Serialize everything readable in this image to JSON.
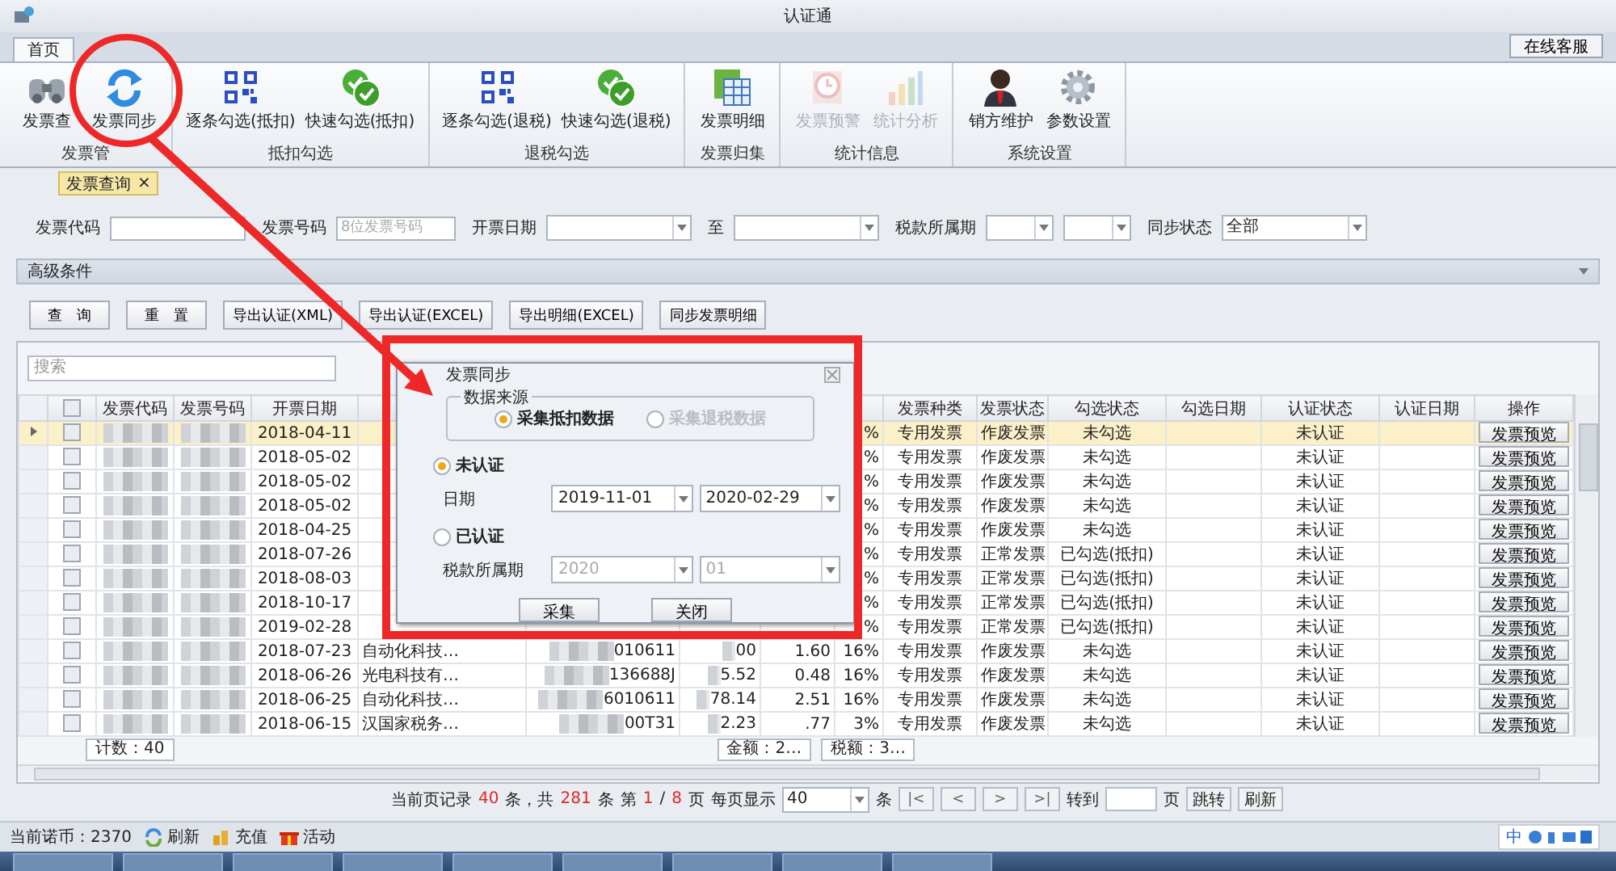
{
  "window": {
    "title": "认证通",
    "service_button": "在线客服"
  },
  "tabs": [
    {
      "label": "首页",
      "selected": true
    }
  ],
  "ribbon": [
    {
      "group": "发票管",
      "items": [
        {
          "label": "发票查",
          "kind": "binoculars",
          "disabled": false
        },
        {
          "label": "发票同步",
          "kind": "sync",
          "disabled": false
        }
      ]
    },
    {
      "group": "抵扣勾选",
      "items": [
        {
          "label": "逐条勾选(抵扣)",
          "kind": "qr",
          "disabled": false
        },
        {
          "label": "快速勾选(抵扣)",
          "kind": "check",
          "disabled": false
        }
      ]
    },
    {
      "group": "退税勾选",
      "items": [
        {
          "label": "逐条勾选(退税)",
          "kind": "qr",
          "disabled": false
        },
        {
          "label": "快速勾选(退税)",
          "kind": "check",
          "disabled": false
        }
      ]
    },
    {
      "group": "发票归集",
      "items": [
        {
          "label": "发票明细",
          "kind": "sheet",
          "disabled": false
        }
      ]
    },
    {
      "group": "统计信息",
      "items": [
        {
          "label": "发票预警",
          "kind": "clock",
          "disabled": true
        },
        {
          "label": "统计分析",
          "kind": "bars",
          "disabled": true
        }
      ]
    },
    {
      "group": "系统设置",
      "items": [
        {
          "label": "销方维护",
          "kind": "person",
          "disabled": false
        },
        {
          "label": "参数设置",
          "kind": "gear",
          "disabled": false
        }
      ]
    }
  ],
  "doc_tab": {
    "label": "发票查询",
    "close": "×"
  },
  "filters": [
    {
      "kind": "text",
      "label": "发票代码"
    },
    {
      "kind": "text",
      "label": "发票号码",
      "placeholder": "8位发票号码"
    },
    {
      "kind": "combo",
      "label": "开票日期"
    },
    {
      "kind": "combo",
      "label": "至"
    },
    {
      "kind": "combo",
      "label": "税款所属期"
    },
    {
      "kind": "combo"
    },
    {
      "kind": "combo",
      "label": "同步状态",
      "value": "全部"
    }
  ],
  "advanced": "高级条件",
  "actions": [
    "查　询",
    "重　置",
    "导出认证(XML)",
    "导出认证(EXCEL)",
    "导出明细(EXCEL)",
    "同步发票明细"
  ],
  "grid": {
    "search_placeholder": "搜索",
    "all_checked": false,
    "headers": {
      "code": "发票代码",
      "number": "发票号码",
      "date": "开票日期",
      "type": "发票种类",
      "status": "发票状态",
      "check": "勾选状态",
      "check_date": "勾选日期",
      "auth": "认证状态",
      "auth_date": "认证日期",
      "action": "操作"
    },
    "rows": [
      {
        "selected": true,
        "checked": false,
        "date": "2018-04-11",
        "rate": "%",
        "type": "专用发票",
        "status": "作废发票",
        "check": "未勾选",
        "auth": "未认证",
        "action": "发票预览"
      },
      {
        "selected": false,
        "checked": false,
        "date": "2018-05-02",
        "rate": "%",
        "type": "专用发票",
        "status": "作废发票",
        "check": "未勾选",
        "auth": "未认证",
        "action": "发票预览"
      },
      {
        "selected": false,
        "checked": false,
        "date": "2018-05-02",
        "rate": "%",
        "type": "专用发票",
        "status": "作废发票",
        "check": "未勾选",
        "auth": "未认证",
        "action": "发票预览"
      },
      {
        "selected": false,
        "checked": false,
        "date": "2018-05-02",
        "rate": "%",
        "type": "专用发票",
        "status": "作废发票",
        "check": "未勾选",
        "auth": "未认证",
        "action": "发票预览"
      },
      {
        "selected": false,
        "checked": false,
        "date": "2018-04-25",
        "rate": "%",
        "type": "专用发票",
        "status": "作废发票",
        "check": "未勾选",
        "auth": "未认证",
        "action": "发票预览"
      },
      {
        "selected": false,
        "checked": false,
        "date": "2018-07-26",
        "rate": "%",
        "type": "专用发票",
        "status": "正常发票",
        "check": "已勾选(抵扣)",
        "auth": "未认证",
        "action": "发票预览"
      },
      {
        "selected": false,
        "checked": false,
        "date": "2018-08-03",
        "rate": "%",
        "type": "专用发票",
        "status": "正常发票",
        "check": "已勾选(抵扣)",
        "auth": "未认证",
        "action": "发票预览"
      },
      {
        "selected": false,
        "checked": false,
        "date": "2018-10-17",
        "rate": "%",
        "type": "专用发票",
        "status": "正常发票",
        "check": "已勾选(抵扣)",
        "auth": "未认证",
        "action": "发票预览"
      },
      {
        "selected": false,
        "checked": false,
        "date": "2019-02-28",
        "rate": "%",
        "type": "专用发票",
        "status": "正常发票",
        "check": "已勾选(抵扣)",
        "auth": "未认证",
        "action": "发票预览"
      },
      {
        "selected": false,
        "checked": false,
        "date": "2018-07-23",
        "name": "自动化科技…",
        "tax_id": "010611",
        "amount": "00",
        "tax": "1.60",
        "rate": "16%",
        "type": "专用发票",
        "status": "作废发票",
        "check": "未勾选",
        "auth": "未认证",
        "action": "发票预览"
      },
      {
        "selected": false,
        "checked": false,
        "date": "2018-06-26",
        "name": "光电科技有…",
        "tax_id": "136688J",
        "amount": "5.52",
        "tax": "0.48",
        "rate": "16%",
        "type": "专用发票",
        "status": "作废发票",
        "check": "未勾选",
        "auth": "未认证",
        "action": "发票预览"
      },
      {
        "selected": false,
        "checked": false,
        "date": "2018-06-25",
        "name": "自动化科技…",
        "tax_id": "6010611",
        "amount": "78.14",
        "tax": "2.51",
        "rate": "16%",
        "type": "专用发票",
        "status": "作废发票",
        "check": "未勾选",
        "auth": "未认证",
        "action": "发票预览"
      },
      {
        "selected": false,
        "checked": false,
        "date": "2018-06-15",
        "name": "汉国家税务…",
        "tax_id": "00T31",
        "amount": "2.23",
        "tax": ".77",
        "rate": "3%",
        "type": "专用发票",
        "status": "作废发票",
        "check": "未勾选",
        "auth": "未认证",
        "action": "发票预览"
      }
    ],
    "count": "计数：40",
    "amount_total": "金额：2…",
    "tax_total": "税额：3…"
  },
  "dialog": {
    "title": "发票同步",
    "legend": "数据来源",
    "sources": [
      {
        "label": "采集抵扣数据",
        "selected": true,
        "disabled": false
      },
      {
        "label": "采集退税数据",
        "selected": false,
        "disabled": true
      }
    ],
    "modes": [
      {
        "label": "未认证",
        "selected": true,
        "field_label": "日期",
        "values": [
          "2019-11-01",
          "2020-02-29"
        ],
        "disabled": false
      },
      {
        "label": "已认证",
        "selected": false,
        "field_label": "税款所属期",
        "values": [
          "2020",
          "01"
        ],
        "disabled": true
      }
    ],
    "buttons": [
      "采集",
      "关闭"
    ]
  },
  "pager": {
    "parts": [
      {
        "text": "当前页记录",
        "kind": "label"
      },
      {
        "text": "40",
        "kind": "number"
      },
      {
        "text": "条，共",
        "kind": "label"
      },
      {
        "text": "281",
        "kind": "number"
      },
      {
        "text": "条",
        "kind": "label"
      },
      {
        "text": "第",
        "kind": "label"
      },
      {
        "text": "1",
        "kind": "number"
      },
      {
        "text": "/",
        "kind": "label"
      },
      {
        "text": "8",
        "kind": "number"
      },
      {
        "text": "页",
        "kind": "label"
      },
      {
        "text": "每页显示",
        "kind": "label"
      }
    ],
    "per_page": "40",
    "per_unit": "条",
    "nav": [
      "|<",
      "<",
      ">",
      ">|"
    ],
    "goto": "转到",
    "goto_unit": "页",
    "jump": "跳转",
    "refresh": "刷新"
  },
  "status": {
    "coins": "当前诺币：2370",
    "links": [
      {
        "label": "刷新",
        "kind": "refresh"
      },
      {
        "label": "充值",
        "kind": "coins"
      },
      {
        "label": "活动",
        "kind": "gift"
      }
    ]
  },
  "ime": {
    "label": "中"
  },
  "annotations": [
    {
      "kind": "circle"
    },
    {
      "kind": "arrow"
    },
    {
      "kind": "frame"
    }
  ]
}
